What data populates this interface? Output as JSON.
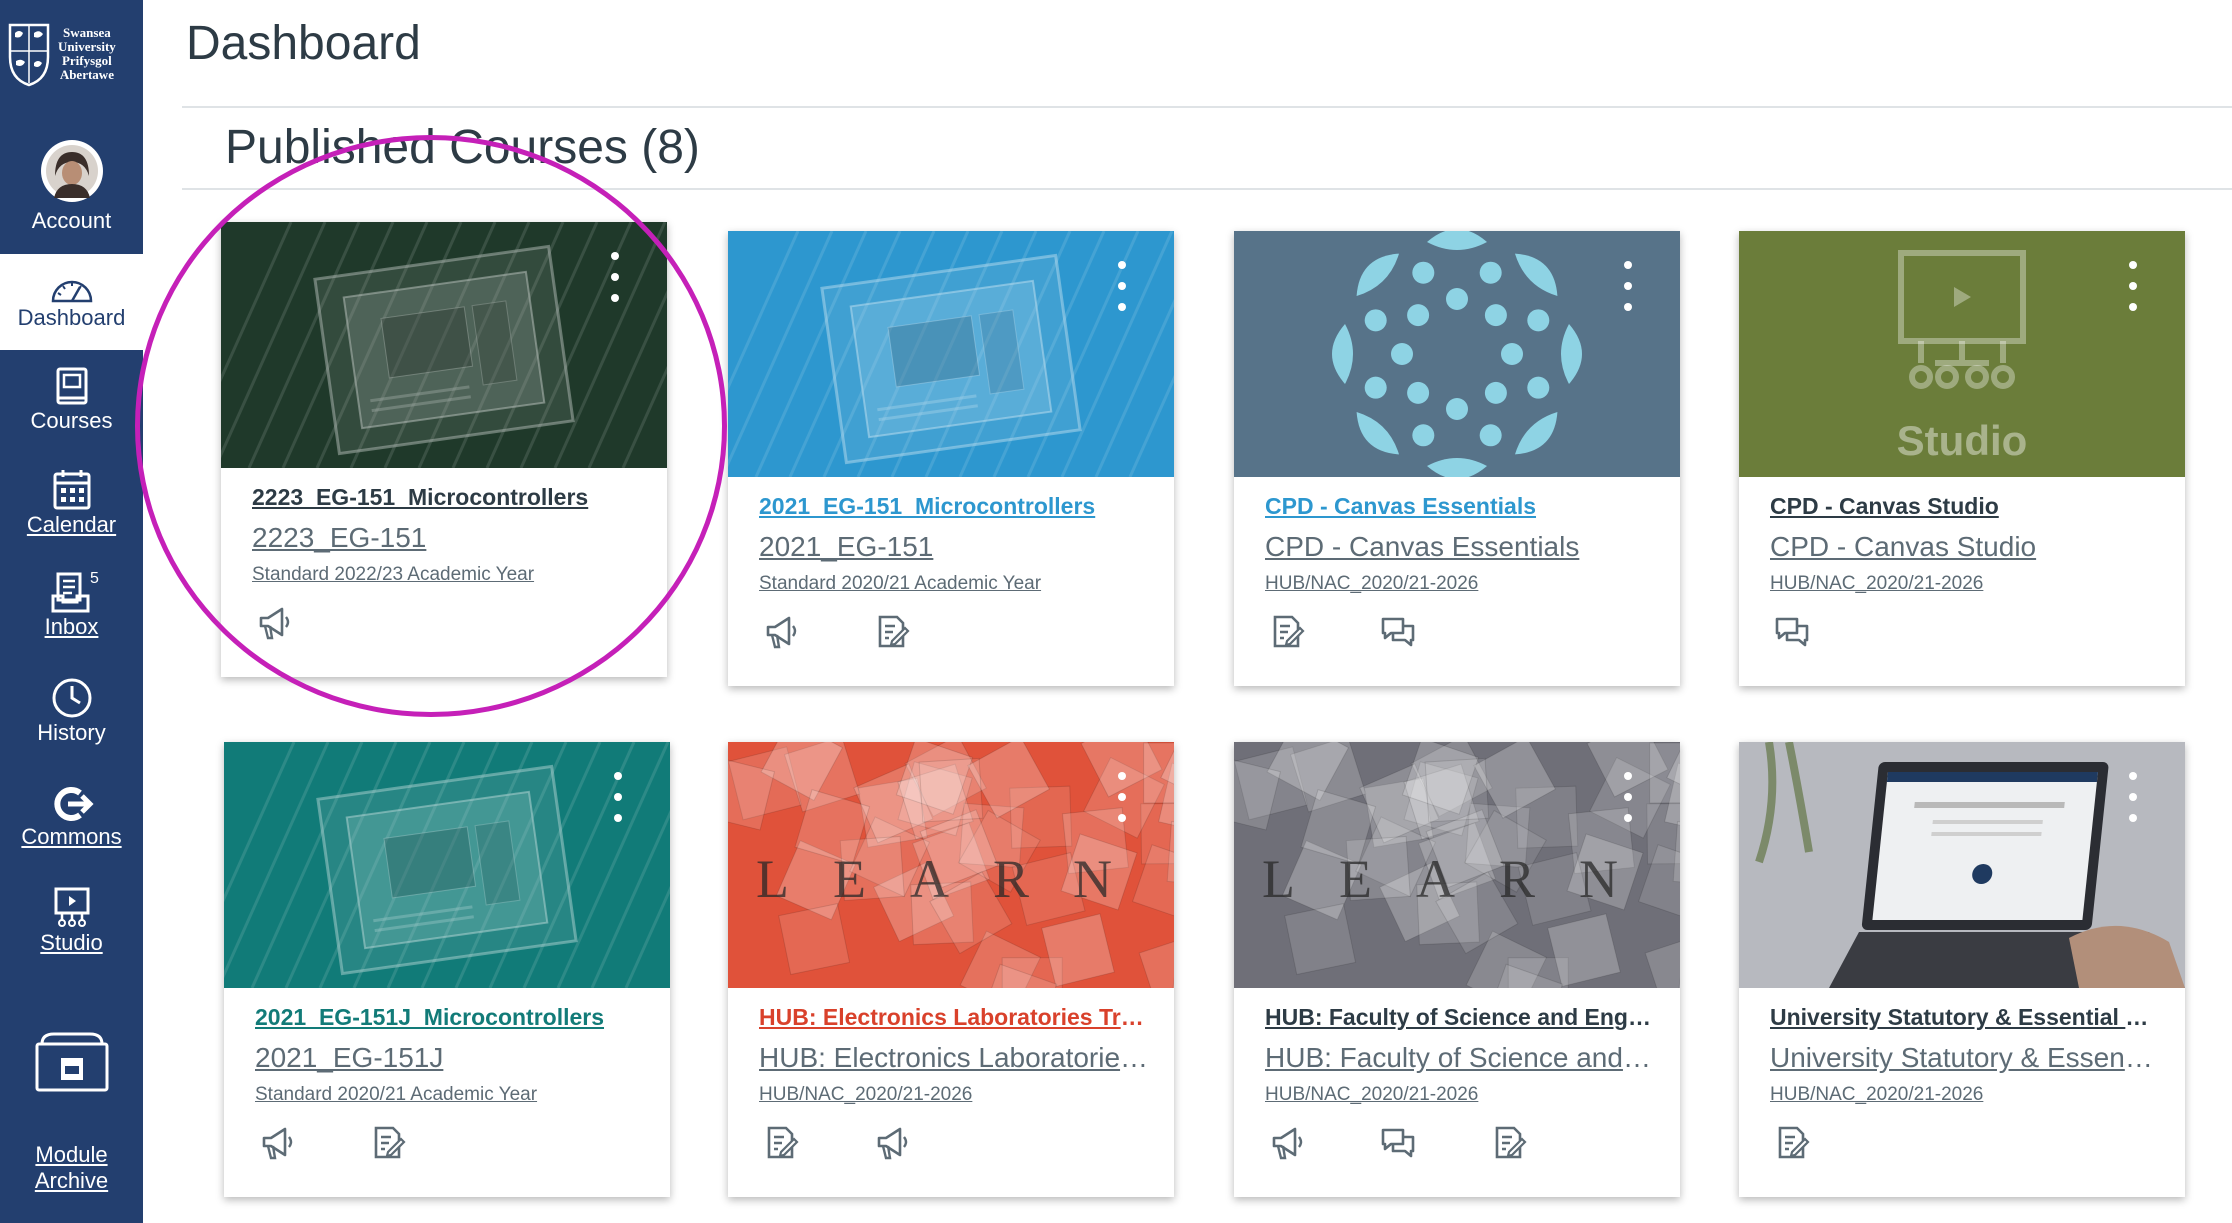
{
  "nav": {
    "logo_lines": [
      "Swansea",
      "University",
      "Prifysgol",
      "Abertawe"
    ],
    "items": [
      {
        "label": "Account"
      },
      {
        "label": "Dashboard"
      },
      {
        "label": "Courses"
      },
      {
        "label": "Calendar"
      },
      {
        "label": "Inbox",
        "badge": "5"
      },
      {
        "label": "History"
      },
      {
        "label": "Commons"
      },
      {
        "label": "Studio"
      },
      {
        "label": "Module Archive"
      }
    ]
  },
  "page": {
    "title": "Dashboard",
    "section_title": "Published Courses (8)"
  },
  "colors": {
    "nav_background": "#233f6f",
    "highlight_ring": "#c520b8",
    "card_teal": "#127b78",
    "card_green": "#6b7d3a",
    "card_blue": "#2d97cf",
    "card_slate": "#577389"
  },
  "cards": [
    {
      "title": "2223_EG-151_Microcontrollers",
      "code": "2223_EG-151",
      "term": "Standard 2022/23 Academic Year",
      "title_color": "#2d3b45",
      "hero": "chip-photo",
      "hero_tint": "#1f3a2a",
      "actions": [
        "announcements-icon"
      ]
    },
    {
      "title": "2021_EG-151_Microcontrollers",
      "code": "2021_EG-151",
      "term": "Standard 2020/21 Academic Year",
      "title_color": "#2d97cf",
      "hero": "chip-photo",
      "hero_tint": "#2d97cf",
      "actions": [
        "announcements-icon",
        "assignments-icon"
      ]
    },
    {
      "title": "CPD - Canvas Essentials",
      "code": "CPD - Canvas Essentials",
      "term": "HUB/NAC_2020/21-2026",
      "title_color": "#2d97cf",
      "hero": "canvas-logo",
      "hero_tint": "#577389",
      "actions": [
        "assignments-icon",
        "discussions-icon"
      ]
    },
    {
      "title": "CPD - Canvas Studio",
      "code": "CPD - Canvas Studio",
      "term": "HUB/NAC_2020/21-2026",
      "title_color": "#2d3b45",
      "hero": "studio-logo",
      "hero_tint": "#6b7d3a",
      "hero_text": "Studio",
      "actions": [
        "discussions-icon"
      ]
    },
    {
      "title": "2021_EG-151J_Microcontrollers",
      "code": "2021_EG-151J",
      "term": "Standard 2020/21 Academic Year",
      "title_color": "#127b78",
      "hero": "chip-photo",
      "hero_tint": "#127b78",
      "actions": [
        "announcements-icon",
        "assignments-icon"
      ]
    },
    {
      "title": "HUB: Electronics Laboratories Trai...",
      "code": "HUB: Electronics Laboratories...",
      "term": "HUB/NAC_2020/21-2026",
      "title_color": "#d9412b",
      "hero": "learn-tiles",
      "hero_tint": "#e0523a",
      "hero_text": "LEARN",
      "actions": [
        "assignments-icon",
        "announcements-icon"
      ]
    },
    {
      "title": "HUB: Faculty of Science and Engin...",
      "code": "HUB: Faculty of Science and E...",
      "term": "HUB/NAC_2020/21-2026",
      "title_color": "#2d3b45",
      "hero": "learn-tiles",
      "hero_tint": "#6f6f78",
      "hero_text": "LEARN",
      "actions": [
        "announcements-icon",
        "discussions-icon",
        "assignments-icon"
      ]
    },
    {
      "title": "University Statutory & Essential Tr...",
      "code": "University Statutory & Essenti...",
      "term": "HUB/NAC_2020/21-2026",
      "title_color": "#2d3b45",
      "hero": "laptop-photo",
      "hero_tint": "#8a8d96",
      "actions": [
        "assignments-icon"
      ]
    }
  ]
}
